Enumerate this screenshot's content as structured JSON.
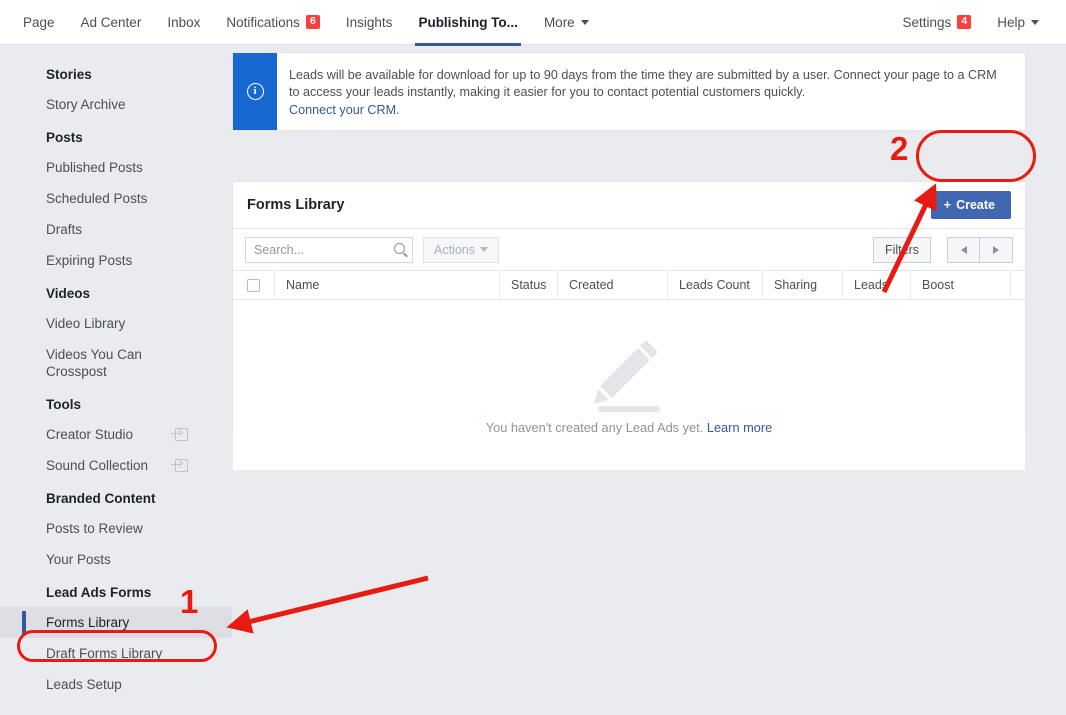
{
  "topnav": {
    "left_items": [
      {
        "label": "Page",
        "badge": null,
        "caret": false,
        "active": false
      },
      {
        "label": "Ad Center",
        "badge": null,
        "caret": false,
        "active": false
      },
      {
        "label": "Inbox",
        "badge": null,
        "caret": false,
        "active": false
      },
      {
        "label": "Notifications",
        "badge": "6",
        "caret": false,
        "active": false
      },
      {
        "label": "Insights",
        "badge": null,
        "caret": false,
        "active": false
      },
      {
        "label": "Publishing To...",
        "badge": null,
        "caret": false,
        "active": true
      },
      {
        "label": "More",
        "badge": null,
        "caret": true,
        "active": false
      }
    ],
    "right_items": [
      {
        "label": "Settings",
        "badge": "4",
        "caret": false
      },
      {
        "label": "Help",
        "badge": null,
        "caret": true
      }
    ]
  },
  "sidebar": {
    "groups": [
      {
        "title": "Stories",
        "items": [
          {
            "label": "Story Archive",
            "external": false,
            "selected": false
          }
        ]
      },
      {
        "title": "Posts",
        "items": [
          {
            "label": "Published Posts",
            "external": false,
            "selected": false
          },
          {
            "label": "Scheduled Posts",
            "external": false,
            "selected": false
          },
          {
            "label": "Drafts",
            "external": false,
            "selected": false
          },
          {
            "label": "Expiring Posts",
            "external": false,
            "selected": false
          }
        ]
      },
      {
        "title": "Videos",
        "items": [
          {
            "label": "Video Library",
            "external": false,
            "selected": false
          },
          {
            "label": "Videos You Can Crosspost",
            "external": false,
            "selected": false
          }
        ]
      },
      {
        "title": "Tools",
        "items": [
          {
            "label": "Creator Studio",
            "external": true,
            "selected": false
          },
          {
            "label": "Sound Collection",
            "external": true,
            "selected": false
          }
        ]
      },
      {
        "title": "Branded Content",
        "items": [
          {
            "label": "Posts to Review",
            "external": false,
            "selected": false
          },
          {
            "label": "Your Posts",
            "external": false,
            "selected": false
          }
        ]
      },
      {
        "title": "Lead Ads Forms",
        "items": [
          {
            "label": "Forms Library",
            "external": false,
            "selected": true
          },
          {
            "label": "Draft Forms Library",
            "external": false,
            "selected": false
          },
          {
            "label": "Leads Setup",
            "external": false,
            "selected": false
          }
        ]
      }
    ]
  },
  "info_banner": {
    "icon": "info-icon",
    "text": "Leads will be available for download for up to 90 days from the time they are submitted by a user. Connect your page to a CRM to access your leads instantly, making it easier for you to contact potential customers quickly.",
    "link": "Connect your CRM."
  },
  "panel": {
    "title": "Forms Library",
    "create_label": "Create",
    "create_plus": "+",
    "search_placeholder": "Search...",
    "search_value": "",
    "actions_label": "Actions",
    "filters_label": "Filters",
    "columns": [
      "Name",
      "Status",
      "Created",
      "Leads Count",
      "Sharing",
      "Leads",
      "Boost"
    ],
    "empty_text": "You haven't created any Lead Ads yet.",
    "empty_link": "Learn more"
  },
  "annotations": {
    "step1": "1",
    "step2": "2",
    "color": "#e81b12"
  }
}
